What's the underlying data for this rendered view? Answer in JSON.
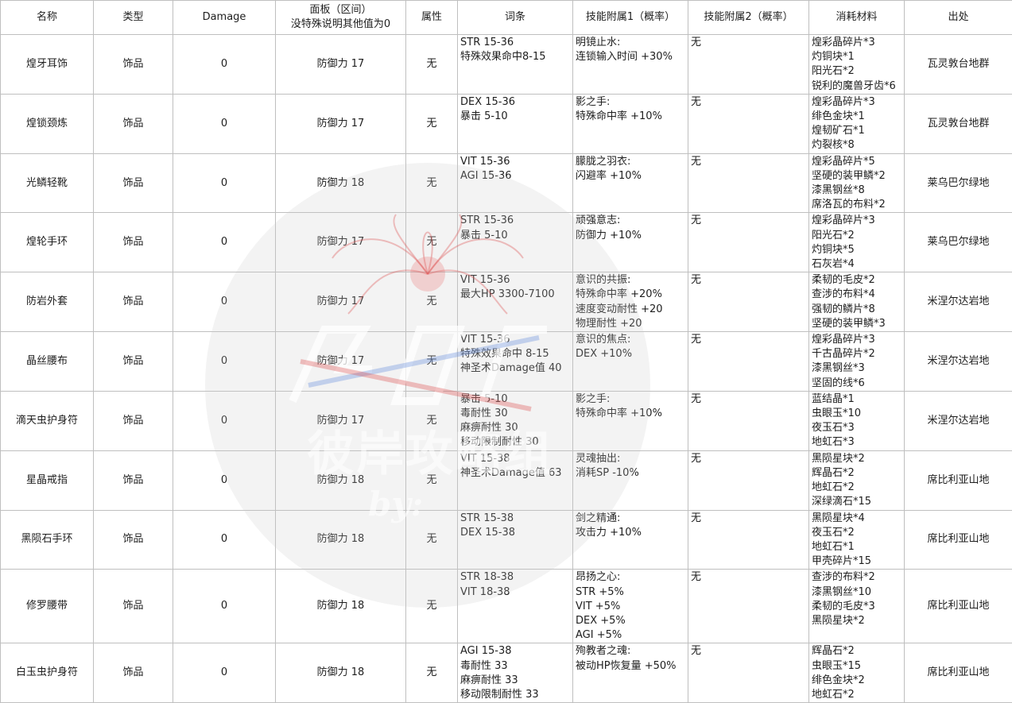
{
  "headers": {
    "name": "名称",
    "type": "类型",
    "damage": "Damage",
    "panel_line1": "面板（区间）",
    "panel_line2": "没特殊说明其他值为0",
    "attr": "属性",
    "affix": "词条",
    "skill1": "技能附属1（概率）",
    "skill2": "技能附属2（概率）",
    "materials": "消耗材料",
    "source": "出处"
  },
  "rows": [
    {
      "name": "煌牙耳饰",
      "type": "饰品",
      "damage": "0",
      "panel": "防御力 17",
      "attr": "无",
      "affix": [
        "STR 15-36",
        "特殊效果命中8-15"
      ],
      "skill1": [
        "明镜止水:",
        "连锁输入时间 +30%"
      ],
      "skill2": "无",
      "materials": [
        "煌彩晶碎片*3",
        "灼铜块*1",
        "阳光石*2",
        "锐利的魔兽牙齿*6"
      ],
      "source": "瓦灵敦台地群"
    },
    {
      "name": "煌锁颈炼",
      "type": "饰品",
      "damage": "0",
      "panel": "防御力 17",
      "attr": "无",
      "affix": [
        "DEX 15-36",
        "暴击 5-10"
      ],
      "skill1": [
        "影之手:",
        "特殊命中率 +10%"
      ],
      "skill2": "无",
      "materials": [
        "煌彩晶碎片*3",
        "绯色金块*1",
        "煌韧矿石*1",
        "灼裂核*8"
      ],
      "source": "瓦灵敦台地群"
    },
    {
      "name": "光鳞轻靴",
      "type": "饰品",
      "damage": "0",
      "panel": "防御力 18",
      "attr": "无",
      "affix": [
        "VIT 15-36",
        "AGI 15-36"
      ],
      "skill1": [
        "朦胧之羽衣:",
        "闪避率 +10%"
      ],
      "skill2": "无",
      "materials": [
        "煌彩晶碎片*5",
        "坚硬的装甲鳞*2",
        "漆黑钢丝*8",
        "席洛瓦的布料*2"
      ],
      "source": "莱乌巴尔绿地"
    },
    {
      "name": "煌轮手环",
      "type": "饰品",
      "damage": "0",
      "panel": "防御力 17",
      "attr": "无",
      "affix": [
        "STR 15-36",
        "暴击 5-10"
      ],
      "skill1": [
        "顽强意志:",
        "防御力 +10%"
      ],
      "skill2": "无",
      "materials": [
        "煌彩晶碎片*3",
        "阳光石*2",
        "灼铜块*5",
        "石灰岩*4"
      ],
      "source": "莱乌巴尔绿地"
    },
    {
      "name": "防岩外套",
      "type": "饰品",
      "damage": "0",
      "panel": "防御力 17",
      "attr": "无",
      "affix": [
        "VIT 15-36",
        "最大HP 3300-7100"
      ],
      "skill1": [
        "意识的共振:",
        "特殊命中率 +20%",
        "速度变动耐性 +20",
        "物理耐性 +20"
      ],
      "skill2": "无",
      "materials": [
        "柔韧的毛皮*2",
        "查涉的布料*4",
        "强韧的鳞片*8",
        "坚硬的装甲鳞*3"
      ],
      "source": "米涅尔达岩地"
    },
    {
      "name": "晶丝腰布",
      "type": "饰品",
      "damage": "0",
      "panel": "防御力 17",
      "attr": "无",
      "affix": [
        "VIT 15-36",
        "特殊效果命中 8-15",
        "神圣术Damage值 40"
      ],
      "skill1": [
        "意识的焦点:",
        "DEX +10%"
      ],
      "skill2": "无",
      "materials": [
        "煌彩晶碎片*3",
        "千古晶碎片*2",
        "漆黑钢丝*3",
        "坚固的线*6"
      ],
      "source": "米涅尔达岩地"
    },
    {
      "name": "滴天虫护身符",
      "type": "饰品",
      "damage": "0",
      "panel": "防御力 17",
      "attr": "无",
      "affix": [
        "暴击 5-10",
        "毒耐性 30",
        "麻痹耐性 30",
        "移动限制耐性 30"
      ],
      "skill1": [
        "影之手:",
        "特殊命中率 +10%"
      ],
      "skill2": "无",
      "materials": [
        "蓝结晶*1",
        "虫眼玉*10",
        "夜玉石*3",
        "地虹石*3"
      ],
      "source": "米涅尔达岩地"
    },
    {
      "name": "星晶戒指",
      "type": "饰品",
      "damage": "0",
      "panel": "防御力 18",
      "attr": "无",
      "affix": [
        "VIT 15-38",
        "神圣术Damage值 63"
      ],
      "skill1": [
        "灵魂抽出:",
        "消耗SP -10%"
      ],
      "skill2": "无",
      "materials": [
        "黑陨星块*2",
        "辉晶石*2",
        "地虹石*2",
        "深绿滴石*15"
      ],
      "source": "席比利亚山地"
    },
    {
      "name": "黑陨石手环",
      "type": "饰品",
      "damage": "0",
      "panel": "防御力 18",
      "attr": "无",
      "affix": [
        "STR 15-38",
        "DEX 15-38"
      ],
      "skill1": [
        "剑之精通:",
        "攻击力 +10%"
      ],
      "skill2": "无",
      "materials": [
        "黑陨星块*4",
        "夜玉石*2",
        "地虹石*1",
        "甲壳碎片*15"
      ],
      "source": "席比利亚山地"
    },
    {
      "name": "修罗腰带",
      "type": "饰品",
      "damage": "0",
      "panel": "防御力 18",
      "attr": "无",
      "affix": [
        "STR 18-38",
        "VIT 18-38"
      ],
      "skill1": [
        "昂扬之心:",
        "STR +5%",
        "VIT +5%",
        "DEX +5%",
        "AGI +5%"
      ],
      "skill2": "无",
      "materials": [
        "查涉的布料*2",
        "漆黑钢丝*10",
        "柔韧的毛皮*3",
        "黑陨星块*2"
      ],
      "source": "席比利亚山地"
    },
    {
      "name": "白玉虫护身符",
      "type": "饰品",
      "damage": "0",
      "panel": "防御力 18",
      "attr": "无",
      "affix": [
        "AGI 15-38",
        "毒耐性 33",
        "麻痹耐性 33",
        "移动限制耐性 33"
      ],
      "skill1": [
        "殉教者之魂:",
        "被动HP恢复量 +50%"
      ],
      "skill2": "无",
      "materials": [
        "辉晶石*2",
        "虫眼玉*15",
        "绯色金块*2",
        "地虹石*2"
      ],
      "source": "席比利亚山地"
    }
  ],
  "watermark": {
    "text": "彼岸攻略组",
    "by": "by:"
  }
}
